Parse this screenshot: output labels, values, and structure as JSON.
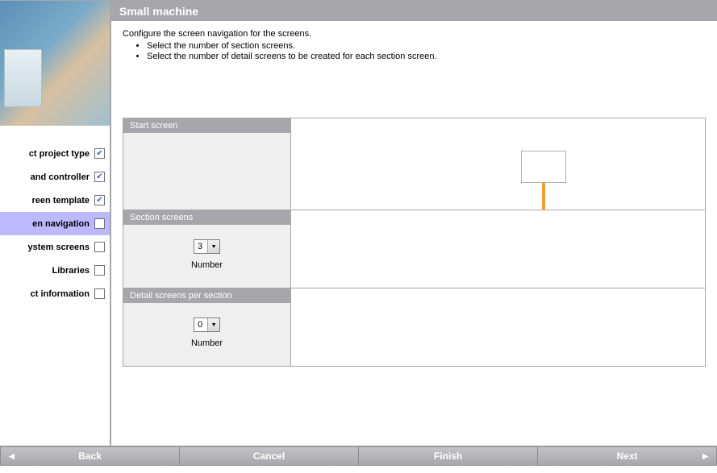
{
  "title": "Small machine",
  "instructions": {
    "heading": "Configure the screen navigation for the screens.",
    "bullets": [
      "Select the number of section screens.",
      "Select the number of detail screens to be created for each section screen."
    ]
  },
  "sidebar": {
    "items": [
      {
        "label": "ct project type",
        "checked": true,
        "active": false
      },
      {
        "label": "and controller",
        "checked": true,
        "active": false
      },
      {
        "label": "reen template",
        "checked": true,
        "active": false
      },
      {
        "label": "en navigation",
        "checked": false,
        "active": true
      },
      {
        "label": "ystem screens",
        "checked": false,
        "active": false
      },
      {
        "label": "Libraries",
        "checked": false,
        "active": false
      },
      {
        "label": "ct information",
        "checked": false,
        "active": false
      }
    ]
  },
  "sections": {
    "start": {
      "title": "Start screen"
    },
    "section": {
      "title": "Section screens",
      "value": "3",
      "label": "Number"
    },
    "detail": {
      "title": "Detail screens per section",
      "value": "0",
      "label": "Number"
    }
  },
  "buttons": {
    "back": "Back",
    "cancel": "Cancel",
    "finish": "Finish",
    "next": "Next"
  }
}
